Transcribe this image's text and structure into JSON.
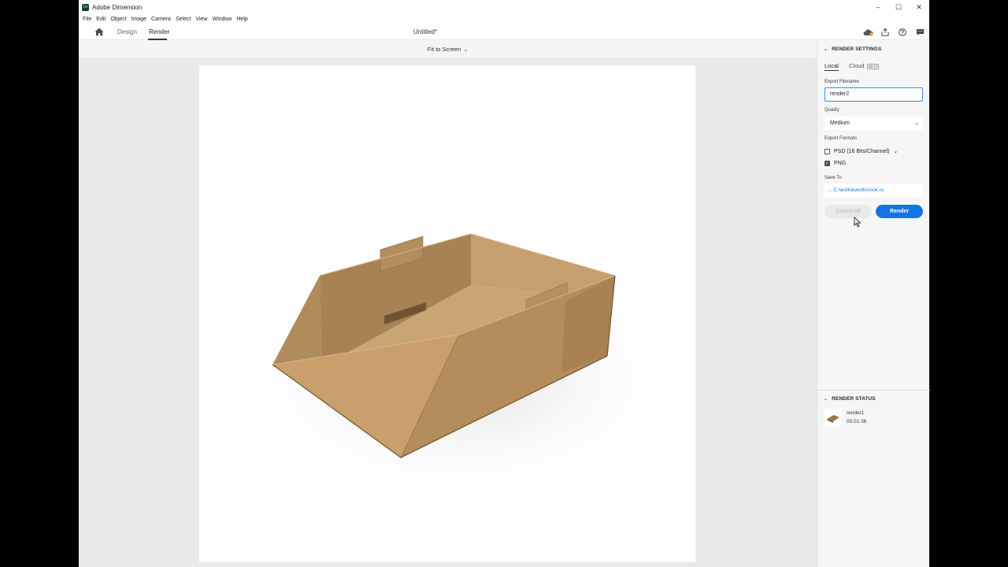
{
  "window": {
    "app_title": "Adobe Dimension",
    "logo_text": "Dn",
    "controls": {
      "minimize": "–",
      "maximize": "☐",
      "close": "✕"
    }
  },
  "menu": [
    "File",
    "Edit",
    "Object",
    "Image",
    "Camera",
    "Select",
    "View",
    "Window",
    "Help"
  ],
  "modebar": {
    "tabs": [
      "Design",
      "Render"
    ],
    "active_tab": "Render",
    "document_title": "Untitled*",
    "icons": [
      "cloud-sync-icon",
      "share-icon",
      "help-icon",
      "feedback-icon"
    ]
  },
  "canvas": {
    "fit_label": "Fit to Screen"
  },
  "render_settings": {
    "title": "RENDER SETTINGS",
    "tabs": [
      "Local",
      "Cloud"
    ],
    "active_tab": "Local",
    "beta_badge": "BETA",
    "export_filename_label": "Export Filename",
    "export_filename_value": "render2",
    "quality_label": "Quality",
    "quality_value": "Medium",
    "export_formats_label": "Export Formats",
    "formats": [
      {
        "label": "PSD (16 Bits/Channel)",
        "checked": false
      },
      {
        "label": "PNG",
        "checked": true
      }
    ],
    "save_to_label": "Save To",
    "save_to_value": "... C:\\work\\kwork\\oook.ru",
    "cancel_label": "Cancel All",
    "render_label": "Render"
  },
  "render_status": {
    "title": "RENDER STATUS",
    "items": [
      {
        "name": "render1",
        "time": "00:01:36"
      }
    ]
  },
  "colors": {
    "accent": "#1473e6",
    "cardboard": "#b58f5f"
  }
}
